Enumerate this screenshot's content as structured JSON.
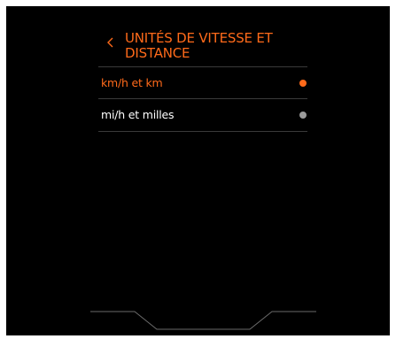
{
  "header": {
    "back_icon": "chevron-left-icon",
    "title": "UNITÉS DE VITESSE ET DISTANCE"
  },
  "options": [
    {
      "label": "km/h et km",
      "selected": true
    },
    {
      "label": "mi/h et milles",
      "selected": false
    }
  ],
  "colors": {
    "accent": "#ff6a1a",
    "text": "#ffffff",
    "background": "#000000",
    "divider": "#3a3a3a",
    "radio_selected": "#ff6a1a",
    "radio_unselected": "#9a9a9a"
  }
}
